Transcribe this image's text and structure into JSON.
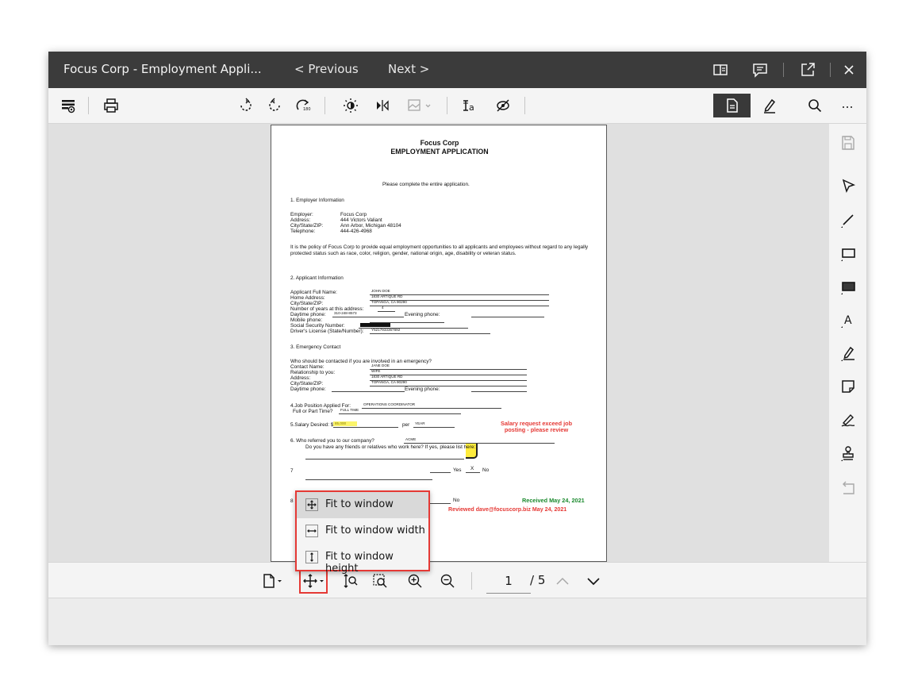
{
  "window": {
    "title": "Focus Corp - Employment Appli...",
    "prev_label": "< Previous",
    "next_label": "Next >"
  },
  "icons": {
    "titlebar": [
      "panel-icon",
      "comment-icon",
      "launch-icon",
      "close-icon"
    ],
    "toolbar_left": [
      "thumbnail-view-icon",
      "print-icon"
    ],
    "toolbar_center": [
      "rotate-dashed-icon",
      "rotate-left-icon",
      "rotate-right-icon",
      "brightness-icon",
      "flip-icon",
      "image-options-icon",
      "text-analysis-icon",
      "hide-icon"
    ],
    "toolbar_right": [
      "view-mode-icon",
      "annotate-mode-icon",
      "search-icon",
      "overflow-menu-icon"
    ],
    "rail": [
      "save-icon",
      "select-pointer-icon",
      "line-icon",
      "rectangle-icon",
      "filled-rectangle-icon",
      "text-icon",
      "highlight-icon",
      "sticky-note-icon",
      "signature-icon",
      "stamp-icon",
      "undo-icon"
    ],
    "bottom": [
      "document-icon",
      "fit-to-window-icon",
      "fit-to-height-icon",
      "zoom-to-selection-icon",
      "zoom-in-icon",
      "zoom-out-icon",
      "page-up-icon",
      "page-down-icon"
    ]
  },
  "pager": {
    "current": "1",
    "total": "/ 5"
  },
  "fit_menu": {
    "items": [
      {
        "label": "Fit to window",
        "icon": "fit-to-window-icon",
        "selected": true
      },
      {
        "label": "Fit to window width",
        "icon": "fit-to-width-icon",
        "selected": false
      },
      {
        "label": "Fit to window height",
        "icon": "fit-to-height-icon",
        "selected": false
      }
    ]
  },
  "document": {
    "company": "Focus Corp",
    "heading": "EMPLOYMENT APPLICATION",
    "instruction": "Please complete the entire application.",
    "section1": "1.     Employer Information",
    "employer_label": "Employer:",
    "employer_value": "Focus Corp",
    "address_label": "Address:",
    "address_value": "444 Victors Valiant",
    "city_label": "City/State/ZIP:",
    "city_value": "Ann Arbor, Michigan 48104",
    "telephone_label": "Telephone:",
    "telephone_value": "444-426-4968",
    "policy_text": "It is the policy of Focus Corp to provide equal employment opportunities to all applicants and employees without regard to any legally protected status such as race, color, religion, gender, national origin, age, disability or veteran status.",
    "section2": "2.     Applicant Information",
    "applicant_name_label": "Applicant Full Name:",
    "applicant_name": "JOHN DOE",
    "home_address_label": "Home Address:",
    "home_address": "1830 ARTIQUE RD",
    "applicant_city_label": "City/State/ZIP:",
    "applicant_city": "TOPANGA, CA 90290",
    "years_label": "Number of years at this address:",
    "years": "4",
    "daytime_label": "Daytime phone:",
    "daytime": "310-248-8573",
    "evening_label": "Evening phone:",
    "mobile_label": "Mobile phone:",
    "ssn_label": "Social Security Number:",
    "license_label": "Driver's License (State/Number):",
    "license": "Y5217933367692",
    "section3": "3.     Emergency Contact",
    "emergency_question": "Who should be contacted if you are involved in an emergency?",
    "contact_label": "Contact Name:",
    "contact": "JANE DOE",
    "relationship_label": "Relationship to you:",
    "relationship": "WIFE",
    "e_address_label": "Address:",
    "e_address": "1830 ARTIQUE RD",
    "e_city_label": "City/State/ZIP:",
    "e_city": "TOPANGA, CA 90290",
    "e_daytime_label": "Daytime phone:",
    "e_evening_label": "Evening phone:",
    "job_label": "4.Job Position Applied For:",
    "job": "OPERATIONS COORDINATOR",
    "fullpart_label": "Full or Part Time?",
    "fullpart": "FULL TIME",
    "salary_label": "5.Salary Desired:   $",
    "salary": "85,000",
    "per_label": "per",
    "per": "YEAR",
    "salary_note": "Salary request exceed job\nposting - please review",
    "section6": "6.     Who referred you to our company?",
    "referrer": "ACME",
    "friends_question": "Do you have any friends or relatives who work here? If yes, please list here:",
    "num7": "7",
    "yes_label": "Yes",
    "yes_mark": "X",
    "no_label": "No",
    "num8": "8",
    "no_label2": "No",
    "received": "Received May 24, 2021",
    "reviewed": "Reviewed dave@focuscorp.biz May 24, 2021"
  },
  "colors": {
    "titlebar_bg": "#3b3b3b",
    "highlight_red": "#e53935",
    "note_red": "#e53935",
    "note_green": "#1b8a2e",
    "sticky_yellow": "#ffec3d"
  }
}
